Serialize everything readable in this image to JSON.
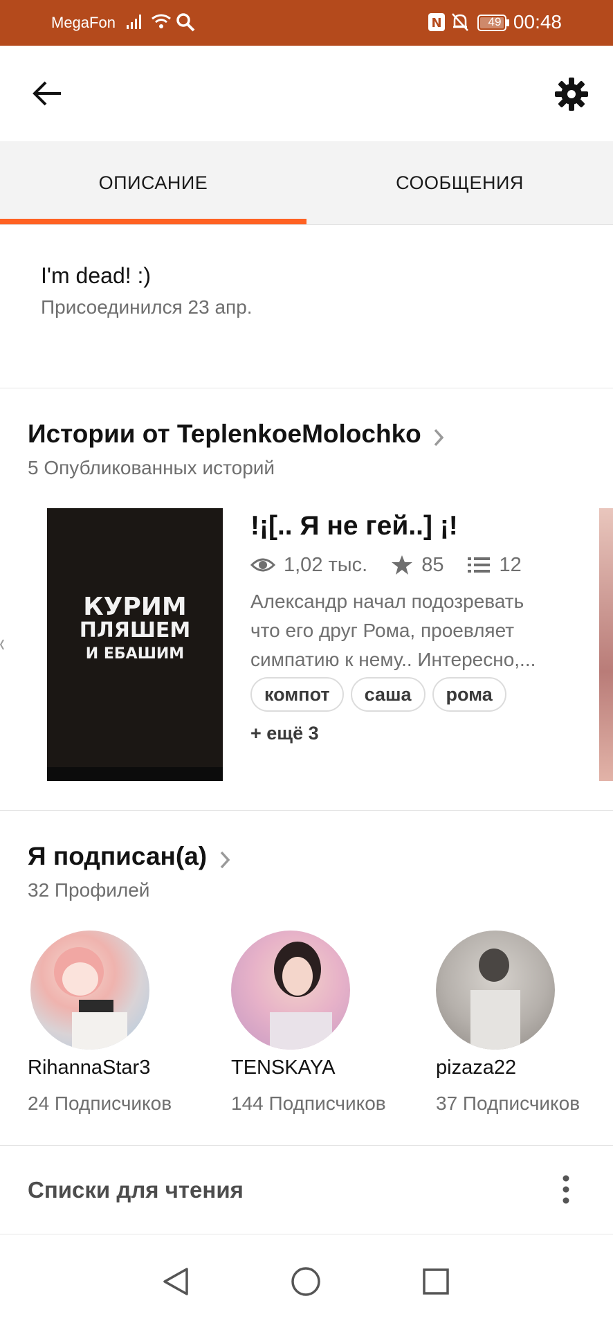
{
  "status_bar": {
    "carrier": "MegaFon",
    "battery": "49",
    "time": "00:48",
    "icons": [
      "signal-icon",
      "wifi-icon",
      "search-icon",
      "nfc-icon",
      "bell-off-icon",
      "battery-icon"
    ],
    "background": "#b44a1c"
  },
  "app_bar": {
    "icons": [
      "back-arrow-icon",
      "gear-icon"
    ]
  },
  "tabs": {
    "items": [
      {
        "label": "ОПИСАНИЕ",
        "active": true
      },
      {
        "label": "СООБЩЕНИЯ",
        "active": false
      }
    ],
    "indicator_color": "#ff6122"
  },
  "about": {
    "text": "I'm dead! :)",
    "joined": "Присоединился 23 апр."
  },
  "stories": {
    "title": "Истории от TeplenkoeMolochko",
    "subtitle": "5 Опубликованных историй",
    "story": {
      "cover_text": [
        "КУРИМ",
        "ПЛЯШЕМ",
        "И ЕБАШИМ"
      ],
      "title": "!¡[.. Я не гей..] ¡!",
      "reads": "1,02 тыс.",
      "votes": "85",
      "parts": "12",
      "description_lines": [
        "Александр начал подозревать",
        "что его друг Рома, проевляет",
        "симпатию к нему.. Интересно,..."
      ],
      "tags": [
        "компот",
        "саша",
        "рома"
      ],
      "more_tags": "+ ещё 3"
    }
  },
  "following": {
    "title": "Я подписан(а)",
    "subtitle": "32 Профилей",
    "users": [
      {
        "name": "RihannaStar3",
        "followers": "24 Подписчиков"
      },
      {
        "name": "TENSKAYA",
        "followers": "144 Подписчиков"
      },
      {
        "name": "pizaza22",
        "followers": "37 Подписчиков"
      }
    ]
  },
  "reading_lists": {
    "label": "Списки для чтения"
  },
  "nav_bar": {
    "icons": [
      "nav-back-icon",
      "nav-home-icon",
      "nav-recents-icon"
    ]
  },
  "colors": {
    "accent": "#ff6122",
    "muted_text": "#6f6f6f"
  }
}
